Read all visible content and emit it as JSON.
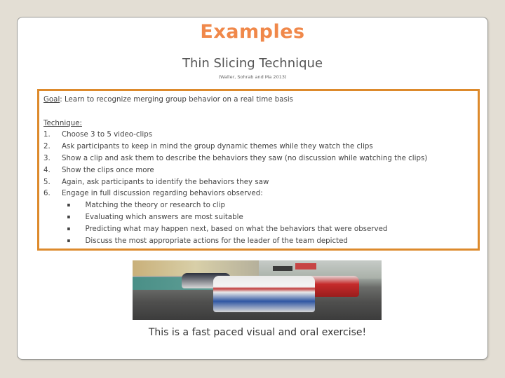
{
  "slide": {
    "title": "Examples",
    "subtitle": "Thin Slicing Technique",
    "citation": "(Waller, Sohrab and Ma 2013)",
    "goal": {
      "label": "Goal",
      "text": ":  Learn to recognize merging group behavior on a real time basis"
    },
    "technique": {
      "label": "Technique:",
      "steps": [
        {
          "num": "1.",
          "text": "Choose 3 to 5 video-clips"
        },
        {
          "num": "2.",
          "text": "Ask participants to keep in mind the group dynamic themes while they watch the clips"
        },
        {
          "num": "3.",
          "text": "Show a clip and ask them to describe the behaviors they saw (no discussion while watching the clips)"
        },
        {
          "num": "4.",
          "text": "Show the clips once more"
        },
        {
          "num": "5.",
          "text": "Again, ask participants to identify the behaviors they saw"
        },
        {
          "num": "6.",
          "text": "Engage in full discussion regarding behaviors observed:"
        }
      ],
      "bullet_char": "▪",
      "sub_bullets": [
        "Matching the theory  or research to clip",
        "Evaluating which answers are most suitable",
        "Predicting what may happen next, based on what the behaviors that were observed",
        "Discuss the most appropriate actions for the leader of the team depicted"
      ]
    },
    "image_alt": "race-cars-photo",
    "caption": "This is a fast paced visual and oral exercise!",
    "colors": {
      "title": "#f0884a",
      "box_border": "#dd8a2c",
      "background": "#e3ded4"
    }
  }
}
